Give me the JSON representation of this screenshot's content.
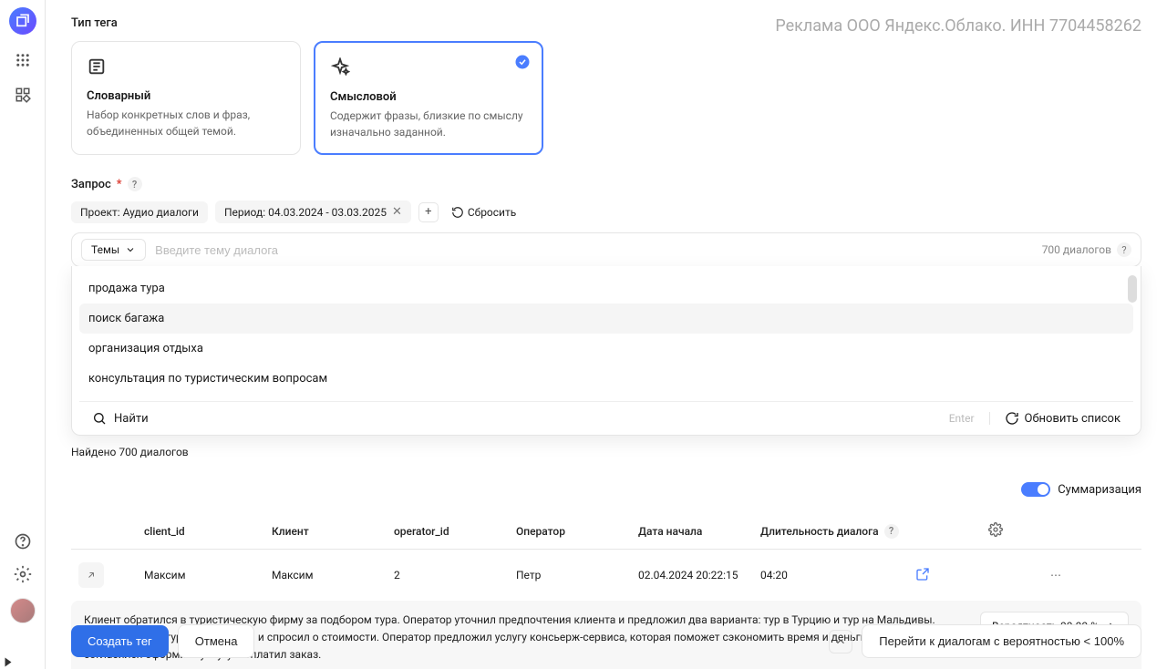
{
  "ad_text": "Реклама ООО Яндекс.Облако. ИНН 7704458262",
  "section_label": "Тип тега",
  "cards": [
    {
      "title": "Словарный",
      "desc": "Набор конкретных слов и фраз, объединенных общей темой."
    },
    {
      "title": "Смысловой",
      "desc": "Содержит фразы, близкие по смыслу изначально заданной."
    }
  ],
  "request_label": "Запрос",
  "chips": {
    "project": "Проект: Аудио диалоги",
    "period": "Период: 04.03.2024 - 03.03.2025"
  },
  "reset_label": "Сбросить",
  "themes_btn": "Темы",
  "search_placeholder": "Введите тему диалога",
  "count_hint": "700 диалогов",
  "dropdown_items": [
    "продажа тура",
    "поиск багажа",
    "организация отдыха",
    "консультация по туристическим вопросам"
  ],
  "dropdown_highlight_idx": 1,
  "dd_find": "Найти",
  "dd_enter": "Enter",
  "dd_refresh": "Обновить список",
  "found_text": "Найдено 700 диалогов",
  "summary_label": "Суммаризация",
  "columns": {
    "client_id": "client_id",
    "client": "Клиент",
    "operator_id": "operator_id",
    "operator": "Оператор",
    "date": "Дата начала",
    "duration": "Длительность диалога"
  },
  "row": {
    "client_id": "Максим",
    "client": "Максим",
    "operator_id": "2",
    "operator": "Петр",
    "date": "02.04.2024 20:22:15",
    "duration": "04:20"
  },
  "summary_text": "Клиент обратился в туристическую фирму за подбором тура. Оператор уточнил предпочтения клиента и предложил два варианта: тур в Турцию и тур на Мальдивы. Клиент выбрал тур на Мальдивы и спросил о стоимости. Оператор предложил услугу консьерж-сервиса, которая поможет сэкономить время и деньги клиента. Клиент согласился оформить услугу и оплатил заказ.",
  "prob_label": "Вероятность 99.99 %",
  "footer": {
    "create": "Создать тег",
    "cancel": "Отмена",
    "goto": "Перейти к диалогам с вероятностью < 100%"
  }
}
